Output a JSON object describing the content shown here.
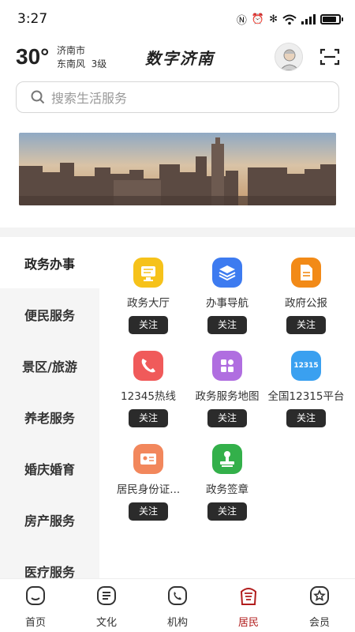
{
  "status": {
    "time": "3:27"
  },
  "header": {
    "temperature": "30°",
    "city": "济南市",
    "wind": "东南风  3级",
    "app_title": "数字济南"
  },
  "search": {
    "placeholder": "搜索生活服务"
  },
  "sidebar": {
    "items": [
      {
        "label": "政务办事",
        "active": true
      },
      {
        "label": "便民服务"
      },
      {
        "label": "景区/旅游"
      },
      {
        "label": "养老服务"
      },
      {
        "label": "婚庆婚育"
      },
      {
        "label": "房产服务"
      },
      {
        "label": "医疗服务"
      }
    ]
  },
  "services": {
    "follow_label": "关注",
    "items": [
      {
        "label": "政务大厅",
        "icon": "monitor-icon",
        "color": "#f6c21a"
      },
      {
        "label": "办事导航",
        "icon": "layers-icon",
        "color": "#3d7bf0"
      },
      {
        "label": "政府公报",
        "icon": "document-icon",
        "color": "#f28a17"
      },
      {
        "label": "12345热线",
        "icon": "phone-icon",
        "color": "#f05a5a"
      },
      {
        "label": "政务服务地图",
        "icon": "grid-icon",
        "color": "#b06ee0"
      },
      {
        "label": "全国12315平台",
        "icon": "badge-12315-icon",
        "color": "#3aa0f0",
        "badge_text": "12315"
      },
      {
        "label": "居民身份证...",
        "icon": "id-card-icon",
        "color": "#f2875c"
      },
      {
        "label": "政务签章",
        "icon": "stamp-icon",
        "color": "#33b04a"
      }
    ]
  },
  "tabbar": {
    "items": [
      {
        "label": "首页",
        "icon": "home-icon"
      },
      {
        "label": "文化",
        "icon": "book-icon"
      },
      {
        "label": "机构",
        "icon": "phone-circle-icon"
      },
      {
        "label": "居民",
        "icon": "resident-icon",
        "active": true
      },
      {
        "label": "会员",
        "icon": "star-badge-icon"
      }
    ]
  }
}
